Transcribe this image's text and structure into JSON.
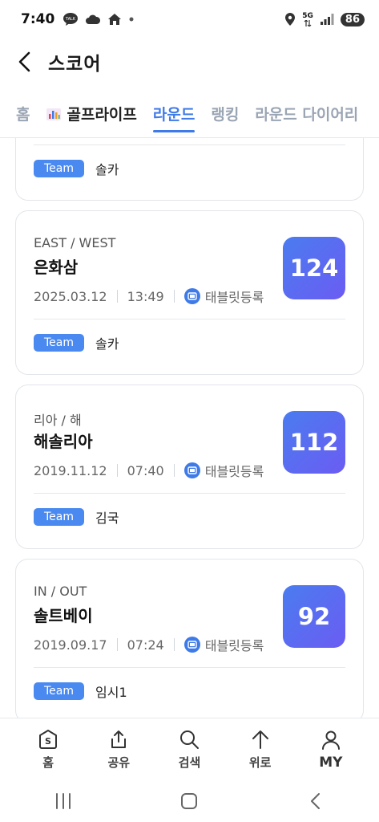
{
  "status_bar": {
    "time": "7:40",
    "network": "5G",
    "battery": "86"
  },
  "header": {
    "title": "스코어"
  },
  "tabs": [
    {
      "label": "홈",
      "state": "inactive"
    },
    {
      "label": "골프라이프",
      "state": "dark"
    },
    {
      "label": "라운드",
      "state": "active"
    },
    {
      "label": "랭킹",
      "state": "inactive"
    },
    {
      "label": "라운드 다이어리",
      "state": "inactive"
    }
  ],
  "partial_card": {
    "team_badge": "Team",
    "team_name": "솔카"
  },
  "rounds": [
    {
      "course": "EAST / WEST",
      "club": "은화삼",
      "date": "2025.03.12",
      "time": "13:49",
      "source": "태블릿등록",
      "score": "124",
      "team_badge": "Team",
      "team_name": "솔카"
    },
    {
      "course": "리아 / 해",
      "club": "해솔리아",
      "date": "2019.11.12",
      "time": "07:40",
      "source": "태블릿등록",
      "score": "112",
      "team_badge": "Team",
      "team_name": "김국"
    },
    {
      "course": "IN / OUT",
      "club": "솔트베이",
      "date": "2019.09.17",
      "time": "07:24",
      "source": "태블릿등록",
      "score": "92",
      "team_badge": "Team",
      "team_name": "임시1"
    }
  ],
  "bottom_nav": [
    {
      "label": "홈",
      "icon": "home-s-icon"
    },
    {
      "label": "공유",
      "icon": "share-icon"
    },
    {
      "label": "검색",
      "icon": "search-icon"
    },
    {
      "label": "위로",
      "icon": "arrow-up-icon"
    },
    {
      "label": "MY",
      "icon": "person-icon"
    }
  ],
  "colors": {
    "accent": "#3f7be8",
    "team_badge": "#4a8af0",
    "score_gradient_start": "#4a7cf0",
    "score_gradient_end": "#6b5cf2"
  }
}
